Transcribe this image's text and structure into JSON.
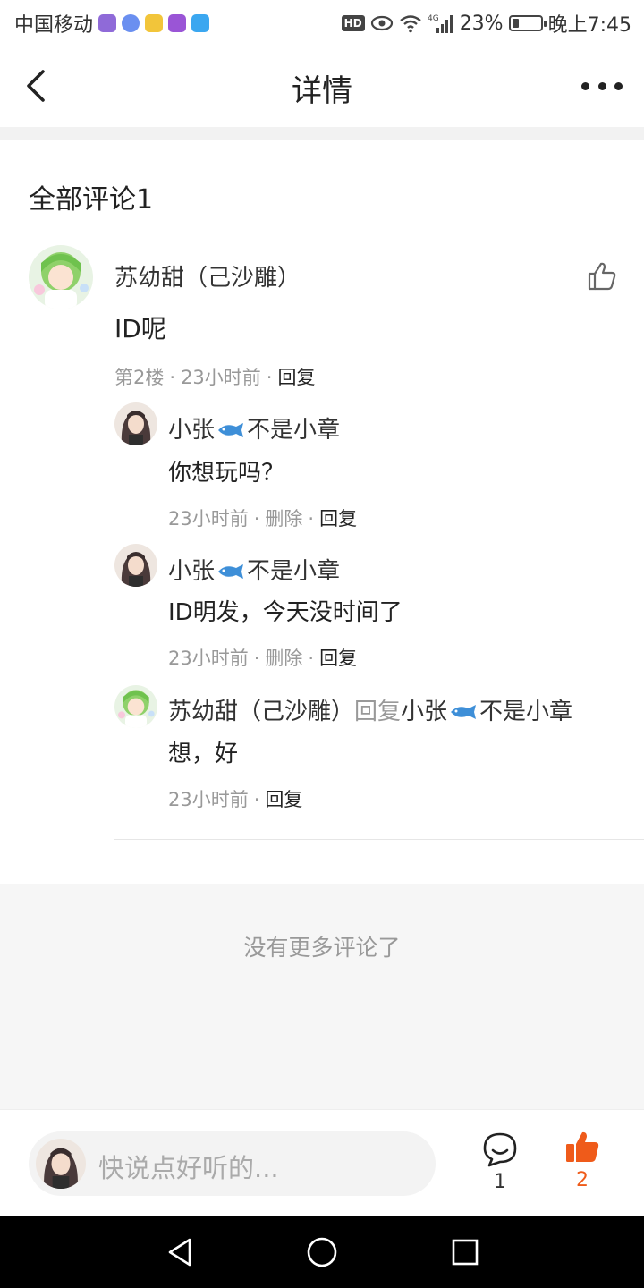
{
  "status_bar": {
    "carrier": "中国移动",
    "app_icons": [
      {
        "name": "app-icon-1",
        "color": "#8f6ad8"
      },
      {
        "name": "app-icon-2",
        "color": "#6a8ff0"
      },
      {
        "name": "app-icon-3",
        "color": "#f2c53a"
      },
      {
        "name": "app-icon-4",
        "color": "#9a55d6"
      },
      {
        "name": "app-icon-5",
        "color": "#3ba7f0"
      }
    ],
    "hd": "HD",
    "network": "4G",
    "battery": "23%",
    "battery_level": 0.23,
    "time": "晚上7:45"
  },
  "header": {
    "title": "详情"
  },
  "comments_title": "全部评论1",
  "comment": {
    "author": "苏幼甜（己沙雕）",
    "text": "ID呢",
    "floor": "第2楼",
    "time": "23小时前",
    "reply_label": "回复",
    "replies": [
      {
        "author_prefix": "小张",
        "author_suffix": "不是小章",
        "text": "你想玩吗？",
        "time": "23小时前",
        "delete_label": "删除",
        "reply_label": "回复"
      },
      {
        "author_prefix": "小张",
        "author_suffix": "不是小章",
        "text": "ID明发，今天没时间了",
        "time": "23小时前",
        "delete_label": "删除",
        "reply_label": "回复"
      },
      {
        "author": "苏幼甜（己沙雕）",
        "reply_word": "回复",
        "target_prefix": "小张",
        "target_suffix": "不是小章",
        "text": "想，好",
        "time": "23小时前",
        "reply_label": "回复"
      }
    ]
  },
  "no_more": "没有更多评论了",
  "bottom_bar": {
    "input_placeholder": "快说点好听的...",
    "comment_count": "1",
    "like_count": "2",
    "accent_color": "#ef5b1a"
  }
}
